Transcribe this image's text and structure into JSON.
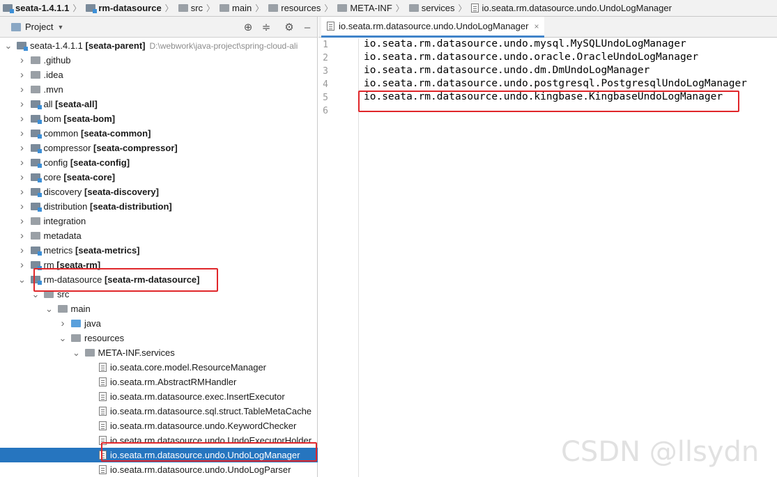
{
  "breadcrumb": [
    {
      "label": "seata-1.4.1.1",
      "icon": "module-icon",
      "bold": true
    },
    {
      "label": "rm-datasource",
      "icon": "module-icon",
      "bold": true
    },
    {
      "label": "src",
      "icon": "folder-icon",
      "bold": false
    },
    {
      "label": "main",
      "icon": "folder-icon",
      "bold": false
    },
    {
      "label": "resources",
      "icon": "resources-folder-icon",
      "bold": false
    },
    {
      "label": "META-INF",
      "icon": "folder-icon",
      "bold": false
    },
    {
      "label": "services",
      "icon": "folder-icon",
      "bold": false
    },
    {
      "label": "io.seata.rm.datasource.undo.UndoLogManager",
      "icon": "file-icon",
      "bold": false
    }
  ],
  "project_panel": {
    "title": "Project",
    "tools": [
      "locate-icon",
      "collapse-icon",
      "gear-icon",
      "minimize-icon"
    ]
  },
  "tree": [
    {
      "name": "seata-1.4.1.1",
      "module": "[seata-parent]",
      "path": "D:\\webwork\\java-project\\spring-cloud-ali",
      "arrow": "open",
      "icon": "module",
      "indent": 0
    },
    {
      "name": ".github",
      "arrow": "closed",
      "icon": "folder",
      "indent": 1
    },
    {
      "name": ".idea",
      "arrow": "closed",
      "icon": "folder",
      "indent": 1
    },
    {
      "name": ".mvn",
      "arrow": "closed",
      "icon": "folder",
      "indent": 1
    },
    {
      "name": "all",
      "module": "[seata-all]",
      "arrow": "closed",
      "icon": "module",
      "indent": 1
    },
    {
      "name": "bom",
      "module": "[seata-bom]",
      "arrow": "closed",
      "icon": "module",
      "indent": 1
    },
    {
      "name": "common",
      "module": "[seata-common]",
      "arrow": "closed",
      "icon": "module",
      "indent": 1
    },
    {
      "name": "compressor",
      "module": "[seata-compressor]",
      "arrow": "closed",
      "icon": "module",
      "indent": 1
    },
    {
      "name": "config",
      "module": "[seata-config]",
      "arrow": "closed",
      "icon": "module",
      "indent": 1
    },
    {
      "name": "core",
      "module": "[seata-core]",
      "arrow": "closed",
      "icon": "module",
      "indent": 1
    },
    {
      "name": "discovery",
      "module": "[seata-discovery]",
      "arrow": "closed",
      "icon": "module",
      "indent": 1
    },
    {
      "name": "distribution",
      "module": "[seata-distribution]",
      "arrow": "closed",
      "icon": "module",
      "indent": 1
    },
    {
      "name": "integration",
      "arrow": "closed",
      "icon": "folder",
      "indent": 1
    },
    {
      "name": "metadata",
      "arrow": "closed",
      "icon": "folder",
      "indent": 1
    },
    {
      "name": "metrics",
      "module": "[seata-metrics]",
      "arrow": "closed",
      "icon": "module",
      "indent": 1
    },
    {
      "name": "rm",
      "module": "[seata-rm]",
      "arrow": "closed",
      "icon": "module",
      "indent": 1
    },
    {
      "name": "rm-datasource",
      "module": "[seata-rm-datasource]",
      "arrow": "open",
      "icon": "module",
      "indent": 1
    },
    {
      "name": "src",
      "arrow": "open",
      "icon": "folder",
      "indent": 2
    },
    {
      "name": "main",
      "arrow": "open",
      "icon": "folder",
      "indent": 3
    },
    {
      "name": "java",
      "arrow": "closed",
      "icon": "folder-blue",
      "indent": 4
    },
    {
      "name": "resources",
      "arrow": "open",
      "icon": "folder",
      "indent": 4
    },
    {
      "name": "META-INF.services",
      "arrow": "open",
      "icon": "folder",
      "indent": 5
    },
    {
      "name": "io.seata.core.model.ResourceManager",
      "arrow": "none",
      "icon": "file",
      "indent": 6
    },
    {
      "name": "io.seata.rm.AbstractRMHandler",
      "arrow": "none",
      "icon": "file",
      "indent": 6
    },
    {
      "name": "io.seata.rm.datasource.exec.InsertExecutor",
      "arrow": "none",
      "icon": "file",
      "indent": 6
    },
    {
      "name": "io.seata.rm.datasource.sql.struct.TableMetaCache",
      "arrow": "none",
      "icon": "file",
      "indent": 6
    },
    {
      "name": "io.seata.rm.datasource.undo.KeywordChecker",
      "arrow": "none",
      "icon": "file",
      "indent": 6
    },
    {
      "name": "io.seata.rm.datasource.undo.UndoExecutorHolder",
      "arrow": "none",
      "icon": "file",
      "indent": 6
    },
    {
      "name": "io.seata.rm.datasource.undo.UndoLogManager",
      "arrow": "none",
      "icon": "file",
      "indent": 6,
      "selected": true
    },
    {
      "name": "io.seata.rm.datasource.undo.UndoLogParser",
      "arrow": "none",
      "icon": "file",
      "indent": 6
    }
  ],
  "editor": {
    "tab_label": "io.seata.rm.datasource.undo.UndoLogManager",
    "line_numbers": [
      "1",
      "2",
      "3",
      "4",
      "5",
      "6"
    ],
    "lines": [
      "io.seata.rm.datasource.undo.mysql.MySQLUndoLogManager",
      "io.seata.rm.datasource.undo.oracle.OracleUndoLogManager",
      "io.seata.rm.datasource.undo.dm.DmUndoLogManager",
      "io.seata.rm.datasource.undo.postgresql.PostgresqlUndoLogManager",
      "io.seata.rm.datasource.undo.kingbase.KingbaseUndoLogManager",
      ""
    ]
  },
  "highlight_color": "#e0262a",
  "selection_color": "#2675bf",
  "watermark": "CSDN @llsydn"
}
